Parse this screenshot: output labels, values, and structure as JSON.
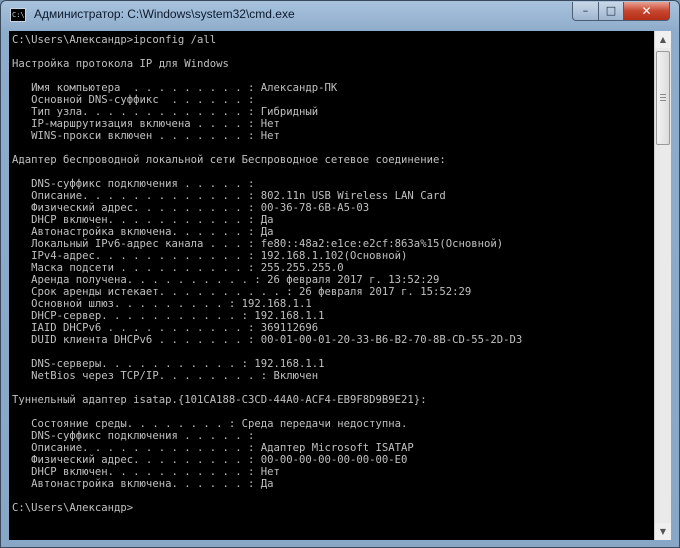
{
  "window": {
    "title": "Администратор: C:\\Windows\\system32\\cmd.exe",
    "icon_text": "C:\\",
    "buttons": {
      "minimize": "–",
      "maximize": "□",
      "close": "✕"
    }
  },
  "console": {
    "output": "C:\\Users\\Александр>ipconfig /all\n\nНастройка протокола IP для Windows\n\n   Имя компьютера  . . . . . . . . . : Александр-ПК\n   Основной DNS-суффикс  . . . . . . :\n   Тип узла. . . . . . . . . . . . . : Гибридный\n   IP-маршрутизация включена . . . . : Нет\n   WINS-прокси включен . . . . . . . : Нет\n\nАдаптер беспроводной локальной сети Беспроводное сетевое соединение:\n\n   DNS-суффикс подключения . . . . . :\n   Описание. . . . . . . . . . . . . : 802.11n USB Wireless LAN Card\n   Физический адрес. . . . . . . . . : 00-36-78-6B-A5-03\n   DHCP включен. . . . . . . . . . . : Да\n   Автонастройка включена. . . . . . : Да\n   Локальный IPv6-адрес канала . . . : fe80::48a2:e1ce:e2cf:863a%15(Основной)\n   IPv4-адрес. . . . . . . . . . . . : 192.168.1.102(Основной)\n   Маска подсети . . . . . . . . . . : 255.255.255.0\n   Аренда получена. . . . . . . . . . : 26 февраля 2017 г. 13:52:29\n   Срок аренды истекает. . . . . . . . . . : 26 февраля 2017 г. 15:52:29\n   Основной шлюз. . . . . . . . . : 192.168.1.1\n   DHCP-сервер. . . . . . . . . . . : 192.168.1.1\n   IAID DHCPv6 . . . . . . . . . . . : 369112696\n   DUID клиента DHCPv6 . . . . . . . : 00-01-00-01-20-33-B6-B2-70-8B-CD-55-2D-D3\n\n   DNS-серверы. . . . . . . . . . . : 192.168.1.1\n   NetBios через TCP/IP. . . . . . . . : Включен\n\nТуннельный адаптер isatap.{101CA188-C3CD-44A0-ACF4-EB9F8D9B9E21}:\n\n   Состояние среды. . . . . . . . : Среда передачи недоступна.\n   DNS-суффикс подключения . . . . . :\n   Описание. . . . . . . . . . . . . : Адаптер Microsoft ISATAP\n   Физический адрес. . . . . . . . . : 00-00-00-00-00-00-00-E0\n   DHCP включен. . . . . . . . . . . : Нет\n   Автонастройка включена. . . . . . : Да\n\nC:\\Users\\Александр>"
  }
}
